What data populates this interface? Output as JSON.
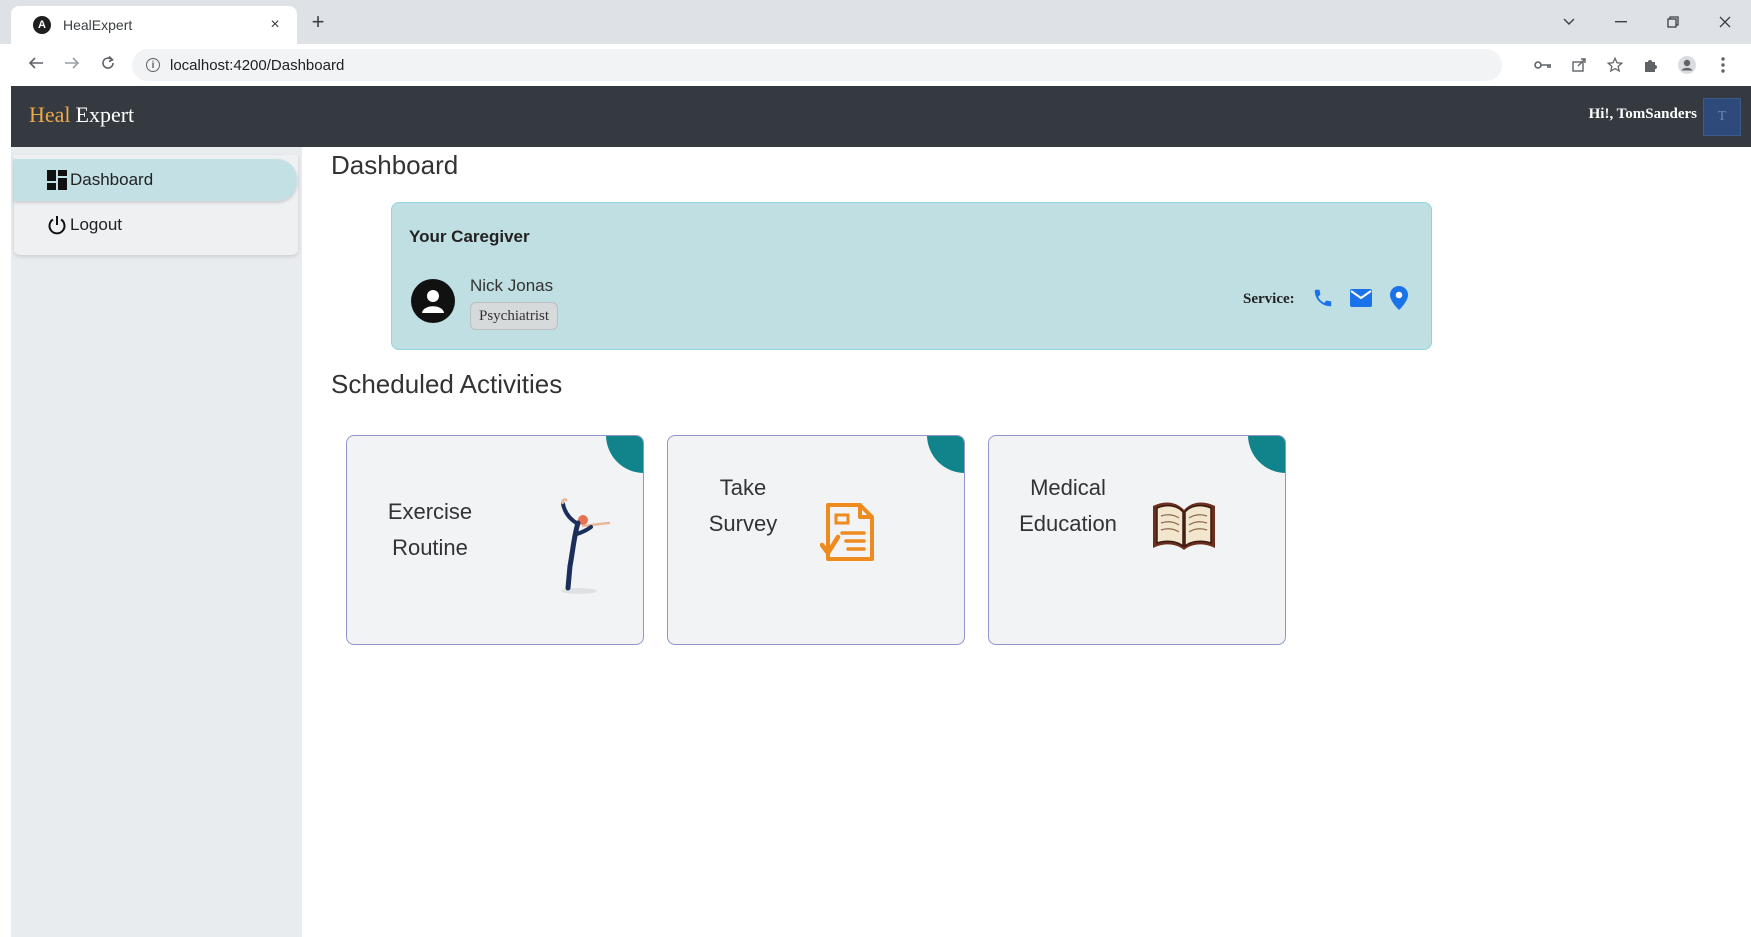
{
  "browser": {
    "tab_title": "HealExpert",
    "tab_close": "×",
    "new_tab": "+",
    "url": "localhost:4200/Dashboard"
  },
  "header": {
    "brand_first": "Heal",
    "brand_second": "Expert",
    "greeting": "Hi!, TomSanders",
    "avatar_initial": "T"
  },
  "sidebar": {
    "items": [
      {
        "label": "Dashboard",
        "icon": "dashboard-icon",
        "active": true
      },
      {
        "label": "Logout",
        "icon": "power-icon",
        "active": false
      }
    ]
  },
  "main": {
    "title": "Dashboard",
    "caregiver": {
      "heading": "Your Caregiver",
      "name": "Nick Jonas",
      "role": "Psychiatrist",
      "service_label": "Service:",
      "service_icons": [
        "phone-icon",
        "mail-icon",
        "location-icon"
      ],
      "accent_color": "#1a73e8"
    },
    "activities_title": "Scheduled Activities",
    "activities": [
      {
        "line1": "Exercise",
        "line2": "Routine",
        "icon": "yoga-figure-icon"
      },
      {
        "line1": "Take",
        "line2": "Survey",
        "icon": "survey-document-icon"
      },
      {
        "line1": "Medical",
        "line2": "Education",
        "icon": "open-book-icon"
      }
    ]
  },
  "colors": {
    "header_bg": "#343a40",
    "brand_accent": "#f0a848",
    "card_corner": "#10848a",
    "caregiver_bg": "#bfdfe2"
  }
}
